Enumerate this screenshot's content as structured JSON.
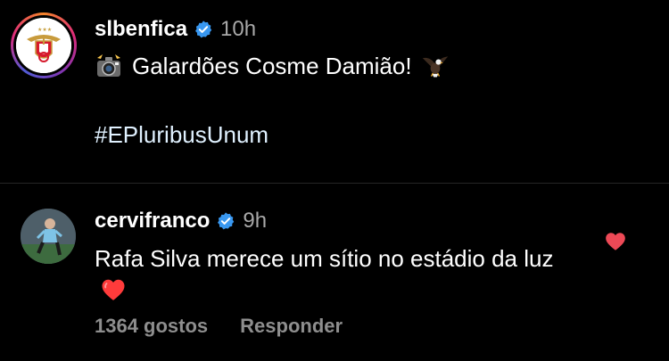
{
  "post": {
    "username": "slbenfica",
    "time": "10h",
    "caption_icon": "camera-flash-emoji",
    "caption": "Galardões Cosme Damião!",
    "caption_trailing_icon": "eagle-emoji",
    "hashtag": "#EPluribusUnum"
  },
  "comment": {
    "username": "cervifranco",
    "time": "9h",
    "text": "Rafa Silva merece um sítio no estádio da luz",
    "text_emoji": "red-heart-emoji",
    "likes": "1364 gostos",
    "reply_label": "Responder",
    "liked": true
  },
  "colors": {
    "background": "#000000",
    "verified": "#3897f0",
    "heart": "#ed4956",
    "muted": "#8e8e8e"
  }
}
